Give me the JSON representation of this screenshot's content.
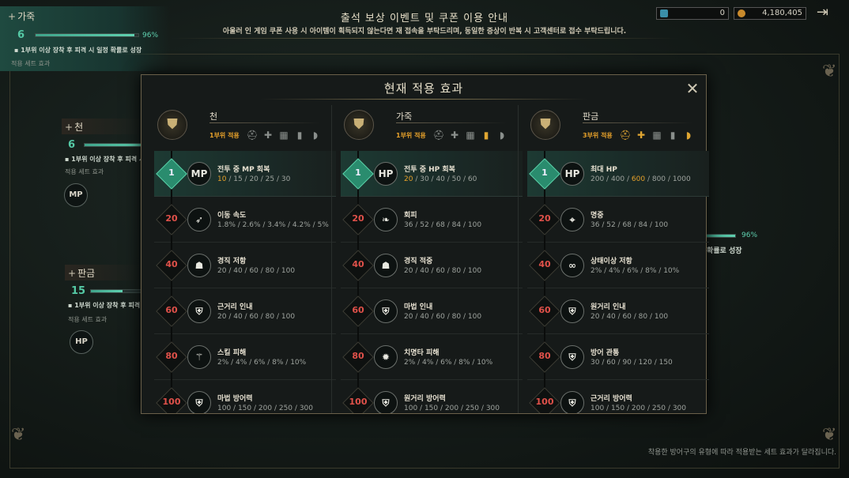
{
  "header": {
    "title": "출석 보상 이벤트 및 쿠폰 이용 안내",
    "subtitle": "아울러 인 게임 쿠폰 사용 시 아이템이 획득되지 않는다면 재 접속을 부탁드리며, 동일한 증상이 반복 시 고객센터로 접수 부탁드립니다.",
    "currency_gem": "0",
    "currency_gold": "4,180,405"
  },
  "side": {
    "leather": {
      "plus": "+",
      "name": "가죽",
      "count": "6",
      "percent": "96%",
      "progress": 0.96,
      "note": "1부위 이상 장착 후 피격 시 일정 확률로 성장",
      "set_label": "적용 세트 효과"
    },
    "cloth": {
      "plus": "+",
      "name": "천",
      "count": "6",
      "note": "1부위 이상 장착 후 피격 시",
      "set_label": "적용 세트 효과",
      "badge": "MP"
    },
    "plate": {
      "plus": "+",
      "name": "판금",
      "count": "15",
      "note": "1부위 이상 장착 후 피격 시",
      "set_label": "적용 세트 효과",
      "badge": "HP"
    },
    "right_percent": "96%",
    "right_note": "확률로 성장"
  },
  "modal": {
    "title": "현재 적용 효과",
    "columns": [
      {
        "name": "천",
        "apply": "1부위 적용",
        "slots_on": [
          false,
          false,
          false,
          false,
          false
        ],
        "rows": [
          {
            "level": "1",
            "icon": "MP",
            "name": "전투 중 MP 회복",
            "vals": [
              "10",
              "15",
              "20",
              "25",
              "30"
            ],
            "hl": 0,
            "active": true
          },
          {
            "level": "20",
            "icon": "speed-icon",
            "name": "이동 속도",
            "vals": [
              "1.8%",
              "2.6%",
              "3.4%",
              "4.2%",
              "5%"
            ],
            "hl": -1,
            "active": false
          },
          {
            "level": "40",
            "icon": "resist-icon",
            "name": "경직 저항",
            "vals": [
              "20",
              "40",
              "60",
              "80",
              "100"
            ],
            "hl": -1,
            "active": false
          },
          {
            "level": "60",
            "icon": "shield-icon",
            "name": "근거리 인내",
            "vals": [
              "20",
              "40",
              "60",
              "80",
              "100"
            ],
            "hl": -1,
            "active": false
          },
          {
            "level": "80",
            "icon": "skill-icon",
            "name": "스킬 피해",
            "vals": [
              "2%",
              "4%",
              "6%",
              "8%",
              "10%"
            ],
            "hl": -1,
            "active": false
          },
          {
            "level": "100",
            "icon": "shield-icon",
            "name": "마법 방어력",
            "vals": [
              "100",
              "150",
              "200",
              "250",
              "300"
            ],
            "hl": -1,
            "active": false
          }
        ]
      },
      {
        "name": "가죽",
        "apply": "1부위 적용",
        "slots_on": [
          false,
          false,
          false,
          true,
          false
        ],
        "rows": [
          {
            "level": "1",
            "icon": "HP",
            "name": "전투 중 HP 회복",
            "vals": [
              "20",
              "30",
              "40",
              "50",
              "60"
            ],
            "hl": 0,
            "active": true
          },
          {
            "level": "20",
            "icon": "evade-icon",
            "name": "회피",
            "vals": [
              "36",
              "52",
              "68",
              "84",
              "100"
            ],
            "hl": -1,
            "active": false
          },
          {
            "level": "40",
            "icon": "hit-icon",
            "name": "경직 적중",
            "vals": [
              "20",
              "40",
              "60",
              "80",
              "100"
            ],
            "hl": -1,
            "active": false
          },
          {
            "level": "60",
            "icon": "shield-icon",
            "name": "마법 인내",
            "vals": [
              "20",
              "40",
              "60",
              "80",
              "100"
            ],
            "hl": -1,
            "active": false
          },
          {
            "level": "80",
            "icon": "crit-icon",
            "name": "치명타 피해",
            "vals": [
              "2%",
              "4%",
              "6%",
              "8%",
              "10%"
            ],
            "hl": -1,
            "active": false
          },
          {
            "level": "100",
            "icon": "shield-icon",
            "name": "원거리 방어력",
            "vals": [
              "100",
              "150",
              "200",
              "250",
              "300"
            ],
            "hl": -1,
            "active": false
          }
        ]
      },
      {
        "name": "판금",
        "apply": "3부위 적용",
        "slots_on": [
          true,
          true,
          false,
          false,
          true
        ],
        "rows": [
          {
            "level": "1",
            "icon": "HP",
            "name": "최대 HP",
            "vals": [
              "200",
              "400",
              "600",
              "800",
              "1000"
            ],
            "hl": 2,
            "active": true
          },
          {
            "level": "20",
            "icon": "target-icon",
            "name": "명중",
            "vals": [
              "36",
              "52",
              "68",
              "84",
              "100"
            ],
            "hl": -1,
            "active": false
          },
          {
            "level": "40",
            "icon": "status-icon",
            "name": "상태이상 저항",
            "vals": [
              "2%",
              "4%",
              "6%",
              "8%",
              "10%"
            ],
            "hl": -1,
            "active": false
          },
          {
            "level": "60",
            "icon": "shield-icon",
            "name": "원거리 인내",
            "vals": [
              "20",
              "40",
              "60",
              "80",
              "100"
            ],
            "hl": -1,
            "active": false
          },
          {
            "level": "80",
            "icon": "shield-icon",
            "name": "방어 관통",
            "vals": [
              "30",
              "60",
              "90",
              "120",
              "150"
            ],
            "hl": -1,
            "active": false
          },
          {
            "level": "100",
            "icon": "shield-icon",
            "name": "근거리 방어력",
            "vals": [
              "100",
              "150",
              "200",
              "250",
              "300"
            ],
            "hl": -1,
            "active": false
          }
        ]
      }
    ]
  },
  "footnote": "착용한 방어구의 유형에 따라 적용받는 세트 효과가 달라집니다."
}
